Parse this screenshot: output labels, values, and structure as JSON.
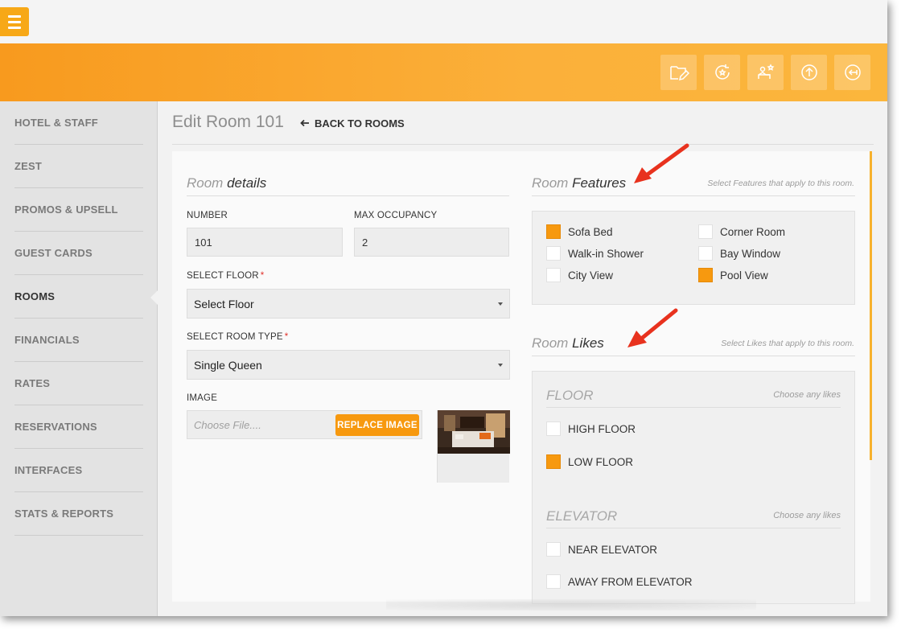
{
  "header": {
    "toolbar": [
      {
        "name": "edit-folder-icon"
      },
      {
        "name": "refresh-star-icon"
      },
      {
        "name": "guest-star-icon"
      },
      {
        "name": "upload-icon"
      },
      {
        "name": "logout-icon"
      }
    ]
  },
  "sidebar": {
    "items": [
      {
        "label": "HOTEL & STAFF"
      },
      {
        "label": "ZEST"
      },
      {
        "label": "PROMOS & UPSELL"
      },
      {
        "label": "GUEST CARDS"
      },
      {
        "label": "ROOMS",
        "active": true
      },
      {
        "label": "FINANCIALS"
      },
      {
        "label": "RATES"
      },
      {
        "label": "RESERVATIONS"
      },
      {
        "label": "INTERFACES"
      },
      {
        "label": "STATS & REPORTS"
      }
    ]
  },
  "page": {
    "title": "Edit Room 101",
    "back_label": "BACK TO ROOMS"
  },
  "details": {
    "heading_light": "Room",
    "heading_bold": "details",
    "number_label": "NUMBER",
    "number_value": "101",
    "occupancy_label": "MAX OCCUPANCY",
    "occupancy_value": "2",
    "floor_label": "SELECT FLOOR",
    "floor_value": "Select Floor",
    "type_label": "SELECT ROOM TYPE",
    "type_value": "Single Queen",
    "image_label": "IMAGE",
    "file_placeholder": "Choose File....",
    "replace_label": "REPLACE IMAGE"
  },
  "features": {
    "heading_light": "Room",
    "heading_bold": "Features",
    "hint": "Select Features that apply to this room.",
    "items": [
      {
        "label": "Sofa Bed",
        "checked": true
      },
      {
        "label": "Corner Room",
        "checked": false
      },
      {
        "label": "Walk-in Shower",
        "checked": false
      },
      {
        "label": "Bay Window",
        "checked": false
      },
      {
        "label": "City View",
        "checked": false
      },
      {
        "label": "Pool View",
        "checked": true
      }
    ]
  },
  "likes": {
    "heading_light": "Room",
    "heading_bold": "Likes",
    "hint": "Select Likes that apply to this room.",
    "groups": [
      {
        "title": "FLOOR",
        "hint": "Choose any likes",
        "options": [
          {
            "label": "HIGH FLOOR",
            "checked": false
          },
          {
            "label": "LOW FLOOR",
            "checked": true
          }
        ]
      },
      {
        "title": "ELEVATOR",
        "hint": "Choose any likes",
        "options": [
          {
            "label": "NEAR ELEVATOR",
            "checked": false
          },
          {
            "label": "AWAY FROM ELEVATOR",
            "checked": false
          }
        ]
      }
    ]
  },
  "colors": {
    "accent": "#f7990f",
    "annotation_arrow": "#e8321e"
  }
}
